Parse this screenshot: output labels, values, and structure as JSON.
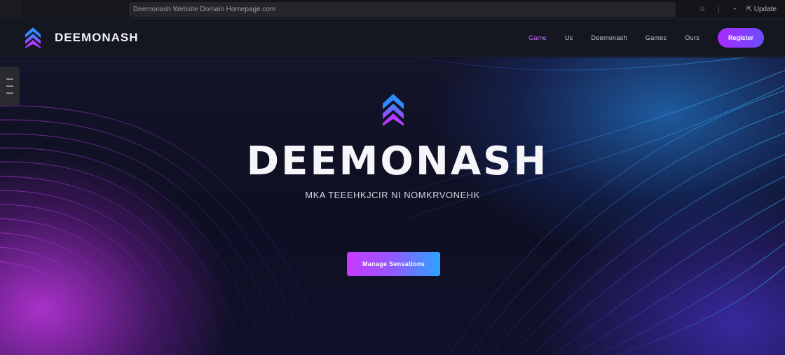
{
  "browser": {
    "url": "Deemonash Website Domain Homepage.com",
    "icons": [
      "star-icon",
      "puzzle-icon",
      "profile-icon",
      "menu-icon"
    ],
    "icon_glyphs": [
      "☆",
      "⋮",
      "◔",
      "⇱"
    ],
    "menu_label": "Update"
  },
  "nav": {
    "brand": "DEEMONASH",
    "links": [
      "Game",
      "Us",
      "Deemonash",
      "Games",
      "Ours"
    ],
    "active_link": "Game",
    "cta": "Register"
  },
  "hero": {
    "title": "DEEMONASH",
    "subtitle": "MKA TEEEHKJCIR NI NOMKRVONEHK",
    "cta": "Manage Sensations"
  },
  "colors": {
    "accent_purple": "#c73bff",
    "accent_blue": "#2aa3ff",
    "nav_bg": "#141620"
  }
}
